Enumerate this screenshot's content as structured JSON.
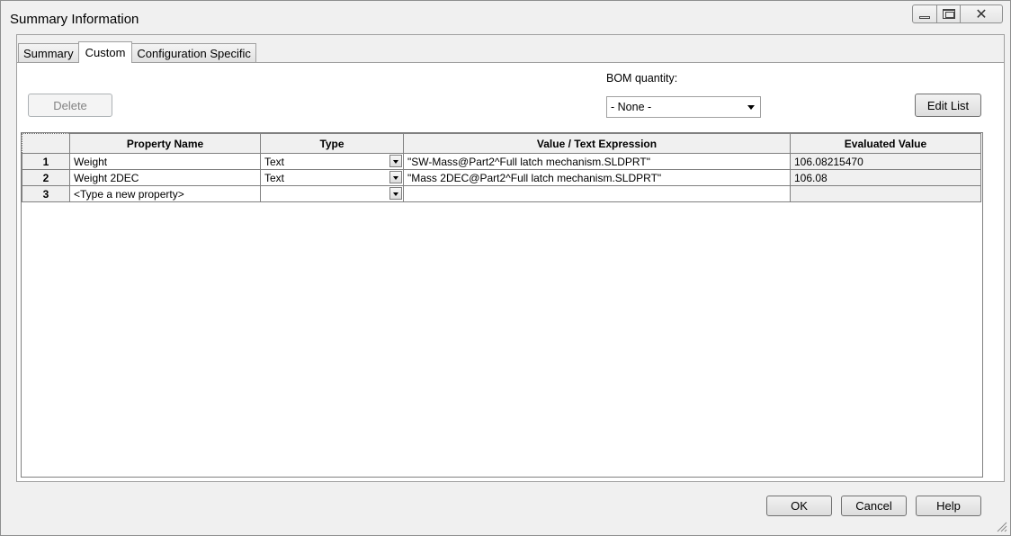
{
  "window": {
    "title": "Summary Information",
    "controls": {
      "minimize_icon": "minimize-icon",
      "maximize_icon": "maximize-icon",
      "close_label": "✕"
    }
  },
  "tabs": [
    {
      "label": "Summary",
      "active": false
    },
    {
      "label": "Custom",
      "active": true
    },
    {
      "label": "Configuration Specific",
      "active": false
    }
  ],
  "toolbar": {
    "delete_label": "Delete",
    "bom_label": "BOM quantity:",
    "bom_value": "- None -",
    "edit_list_label": "Edit List"
  },
  "grid": {
    "columns": [
      "Property Name",
      "Type",
      "Value / Text Expression",
      "Evaluated Value"
    ],
    "rows": [
      {
        "num": "1",
        "name": "Weight",
        "type": "Text",
        "value": "\"SW-Mass@Part2^Full latch mechanism.SLDPRT\"",
        "evaluated": "106.08215470"
      },
      {
        "num": "2",
        "name": "Weight 2DEC",
        "type": "Text",
        "value": "\"Mass 2DEC@Part2^Full latch mechanism.SLDPRT\"",
        "evaluated": "106.08"
      },
      {
        "num": "3",
        "name": "<Type a new property>",
        "type": "",
        "value": "",
        "evaluated": ""
      }
    ]
  },
  "footer": {
    "ok_label": "OK",
    "cancel_label": "Cancel",
    "help_label": "Help"
  }
}
